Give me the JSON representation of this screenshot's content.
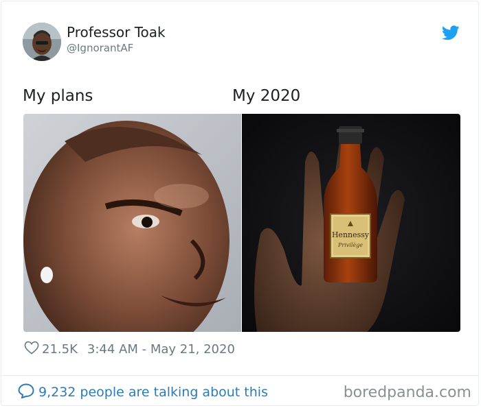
{
  "tweet": {
    "display_name": "Professor Toak",
    "handle": "@IgnorantAF",
    "caption_left": "My plans",
    "caption_right": "My 2020",
    "likes": "21.5K",
    "timestamp": "3:44 AM - May 21, 2020",
    "talking": "9,232 people are talking about this",
    "bottle_brand": "Hennessy",
    "bottle_sub": "Privilège"
  },
  "watermark": "boredpanda.com",
  "icons": {
    "brand": "twitter-bird-icon",
    "like": "heart-icon",
    "reply": "speech-bubble-icon"
  },
  "colors": {
    "twitter_blue": "#1da1f2",
    "link_blue": "#2b7bb9",
    "meta_gray": "#697882",
    "text": "#1c2022"
  }
}
